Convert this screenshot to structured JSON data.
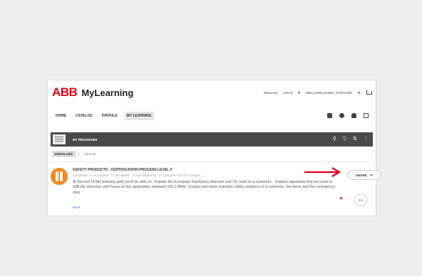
{
  "header": {
    "logo_text": "ABB",
    "app_name": "MyLearning",
    "language": "ENGLISH",
    "currency": "USD $",
    "welcome": "WELCOME DANIEL STRIGARD"
  },
  "nav": {
    "items": [
      "HOME",
      "CATALOG",
      "PROFILE",
      "MY LEARNING"
    ],
    "active": "MY LEARNING"
  },
  "bar": {
    "title": "MY PROGRAMS",
    "thumb_label": "PROGRAMS"
  },
  "filters": {
    "chip": "ENROLLED",
    "clear": "Clear all"
  },
  "course": {
    "title": "SAFETY PRODUCTS - CERTIFICATION PROCESS LEVEL 0",
    "stats": "Completed : 0  |  In progress : 1  |  Incomplete : 0  |  Not Registered : 3  |  Complete 0 out of 7 courses",
    "description": "At the end of this learning path you'll be able to:- Explain the European machinery directive and CE mark to a customer. - Explain standards that are used to fulfil the directive, with focus on the application standard ISO 13849.- Explain two basic machine safety solutions to a customer, the fence and the emergency stop.",
    "more": "More",
    "share": "SHARE",
    "progress": "0%"
  },
  "colors": {
    "brand": "#e2001a",
    "bar": "#4a4a4a",
    "course_icon": "#f08a24"
  }
}
